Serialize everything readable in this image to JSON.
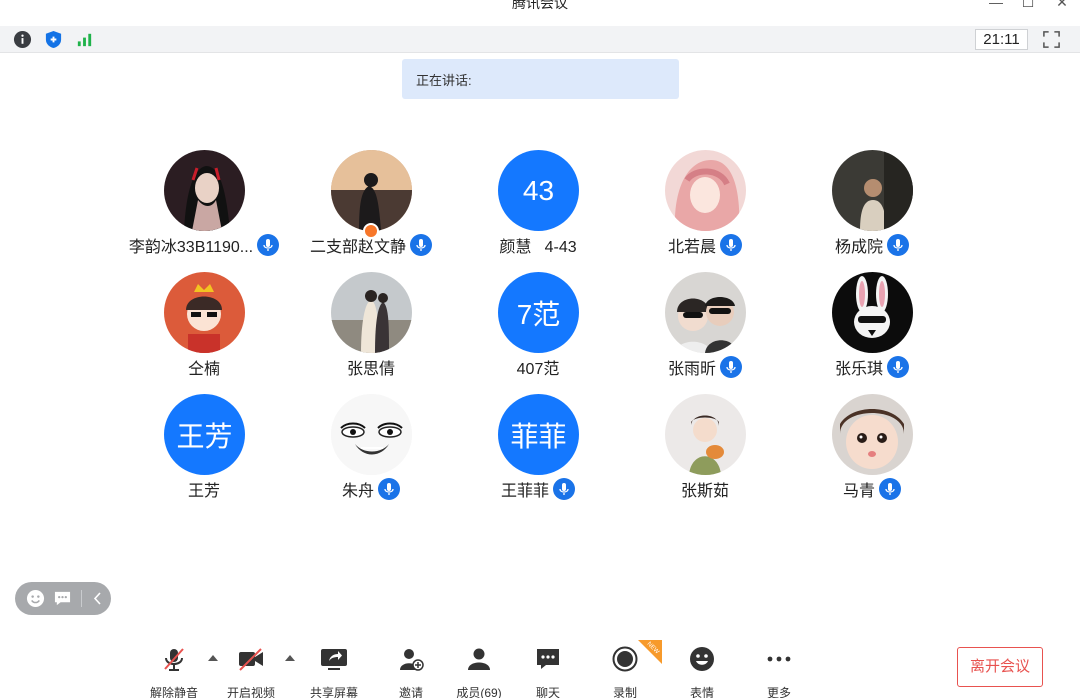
{
  "window": {
    "title": "腾讯会议",
    "minimize": "—",
    "maximize": "☐",
    "close": "✕"
  },
  "infobar": {
    "clock": "21:11"
  },
  "speaking": {
    "label": "正在讲话:"
  },
  "participants": [
    {
      "name": "李韵冰33B1190...",
      "mic": true,
      "avatar_text": ""
    },
    {
      "name": "二支部赵文静",
      "mic": true,
      "avatar_text": ""
    },
    {
      "name": "颜慧   4-43",
      "mic": false,
      "avatar_text": "43"
    },
    {
      "name": "北若晨",
      "mic": true,
      "avatar_text": ""
    },
    {
      "name": "杨成院",
      "mic": true,
      "avatar_text": ""
    },
    {
      "name": "仝楠",
      "mic": false,
      "avatar_text": ""
    },
    {
      "name": "张思倩",
      "mic": false,
      "avatar_text": ""
    },
    {
      "name": "407范",
      "mic": false,
      "avatar_text": "7范"
    },
    {
      "name": "张雨昕",
      "mic": true,
      "avatar_text": ""
    },
    {
      "name": "张乐琪",
      "mic": true,
      "avatar_text": ""
    },
    {
      "name": "王芳",
      "mic": false,
      "avatar_text": "王芳"
    },
    {
      "name": "朱舟",
      "mic": true,
      "avatar_text": ""
    },
    {
      "name": "王菲菲",
      "mic": true,
      "avatar_text": "菲菲"
    },
    {
      "name": "张斯茹",
      "mic": false,
      "avatar_text": ""
    },
    {
      "name": "马青",
      "mic": true,
      "avatar_text": ""
    }
  ],
  "toolbar": {
    "unmute": "解除静音",
    "start_video": "开启视频",
    "share_screen": "共享屏幕",
    "invite": "邀请",
    "members": "成员(69)",
    "chat": "聊天",
    "record": "录制",
    "record_badge": "NEW",
    "reactions": "表情",
    "more": "更多",
    "leave": "离开会议"
  },
  "colors": {
    "accent": "#1478ff",
    "leave": "#e8524f",
    "speaking_bg": "#dde9fb"
  }
}
